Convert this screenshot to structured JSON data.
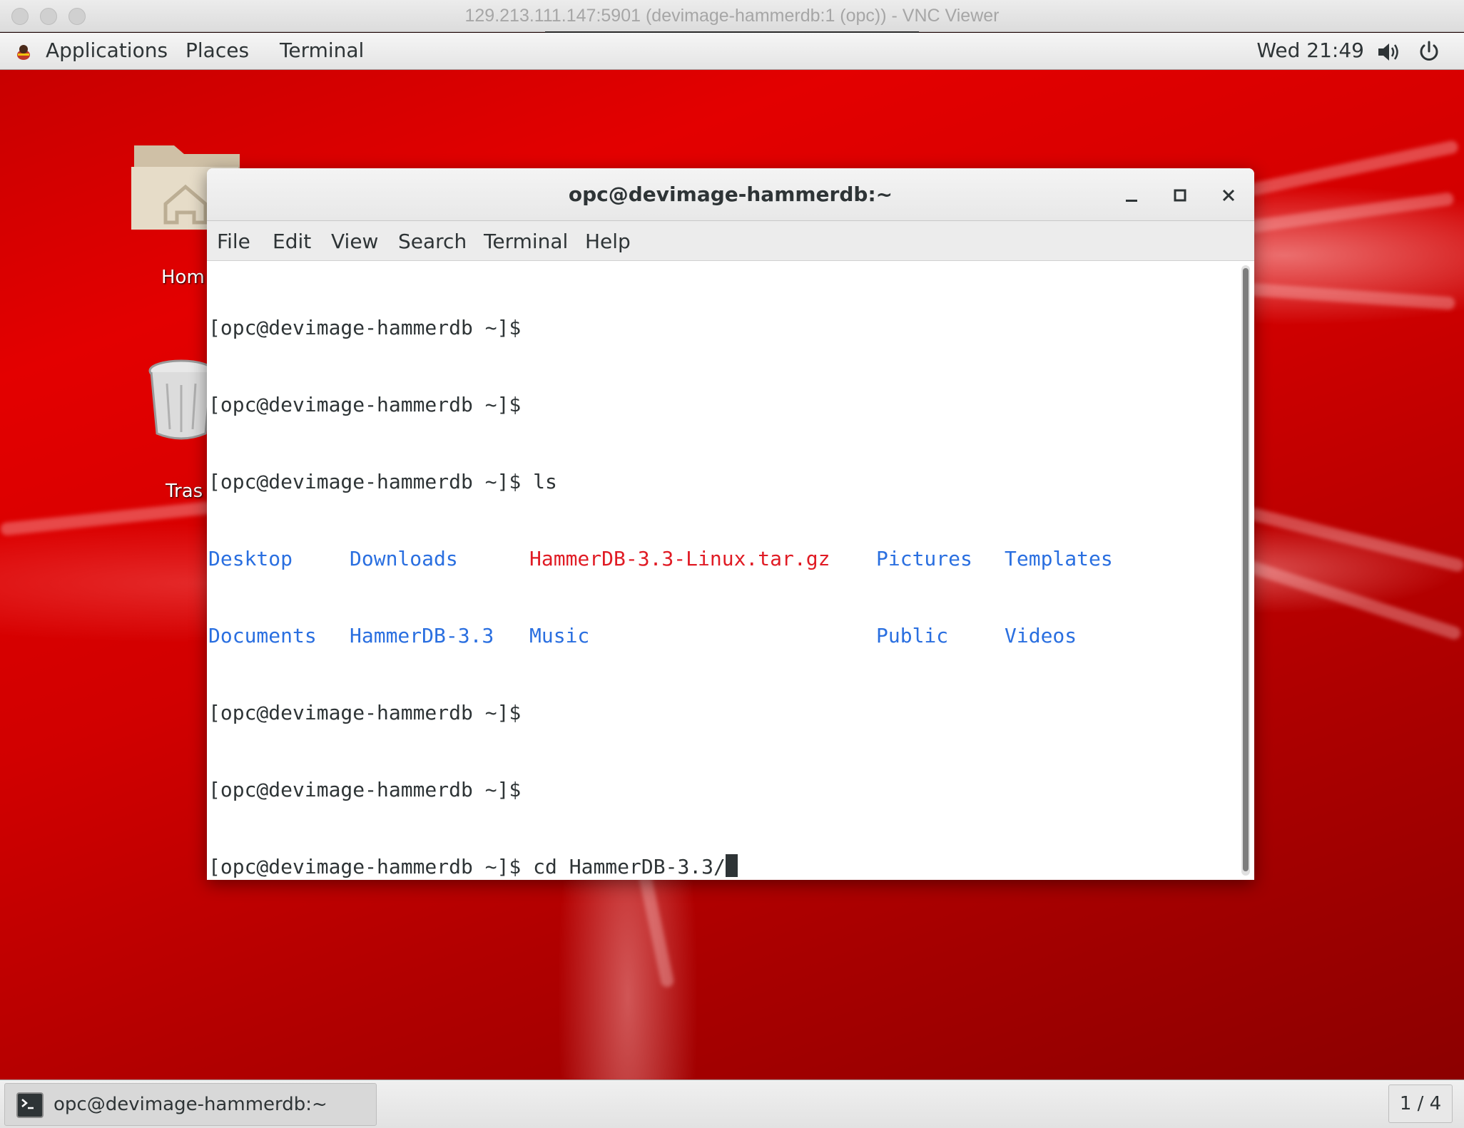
{
  "vnc": {
    "window_title": "129.213.111.147:5901 (devimage-hammerdb:1 (opc)) - VNC Viewer"
  },
  "panel": {
    "applications": "Applications",
    "places": "Places",
    "terminal": "Terminal",
    "clock": "Wed 21:49",
    "icons": [
      "app-menu-icon",
      "volume-icon",
      "power-icon"
    ]
  },
  "desktop": {
    "home_label": "Hom",
    "trash_label": "Tras"
  },
  "terminal": {
    "title": "opc@devimage-hammerdb:~",
    "menu": [
      "File",
      "Edit",
      "View",
      "Search",
      "Terminal",
      "Help"
    ],
    "prompt": "[opc@devimage-hammerdb ~]$",
    "lines": {
      "l1": "[opc@devimage-hammerdb ~]$",
      "l2": "[opc@devimage-hammerdb ~]$",
      "l3": "[opc@devimage-hammerdb ~]$ ls",
      "l6": "[opc@devimage-hammerdb ~]$",
      "l7": "[opc@devimage-hammerdb ~]$",
      "l8": "[opc@devimage-hammerdb ~]$ cd HammerDB-3.3/"
    },
    "ls_row1": [
      "Desktop",
      "Downloads",
      "HammerDB-3.3-Linux.tar.gz",
      "Pictures",
      "Templates"
    ],
    "ls_row2": [
      "Documents",
      "HammerDB-3.3",
      "Music",
      "Public",
      "Videos"
    ],
    "colors": {
      "directory": "#2a6fe0",
      "archive": "#e01b24",
      "text": "#2e3436"
    }
  },
  "taskbar": {
    "window_label": "opc@devimage-hammerdb:~",
    "workspace": "1 / 4"
  }
}
